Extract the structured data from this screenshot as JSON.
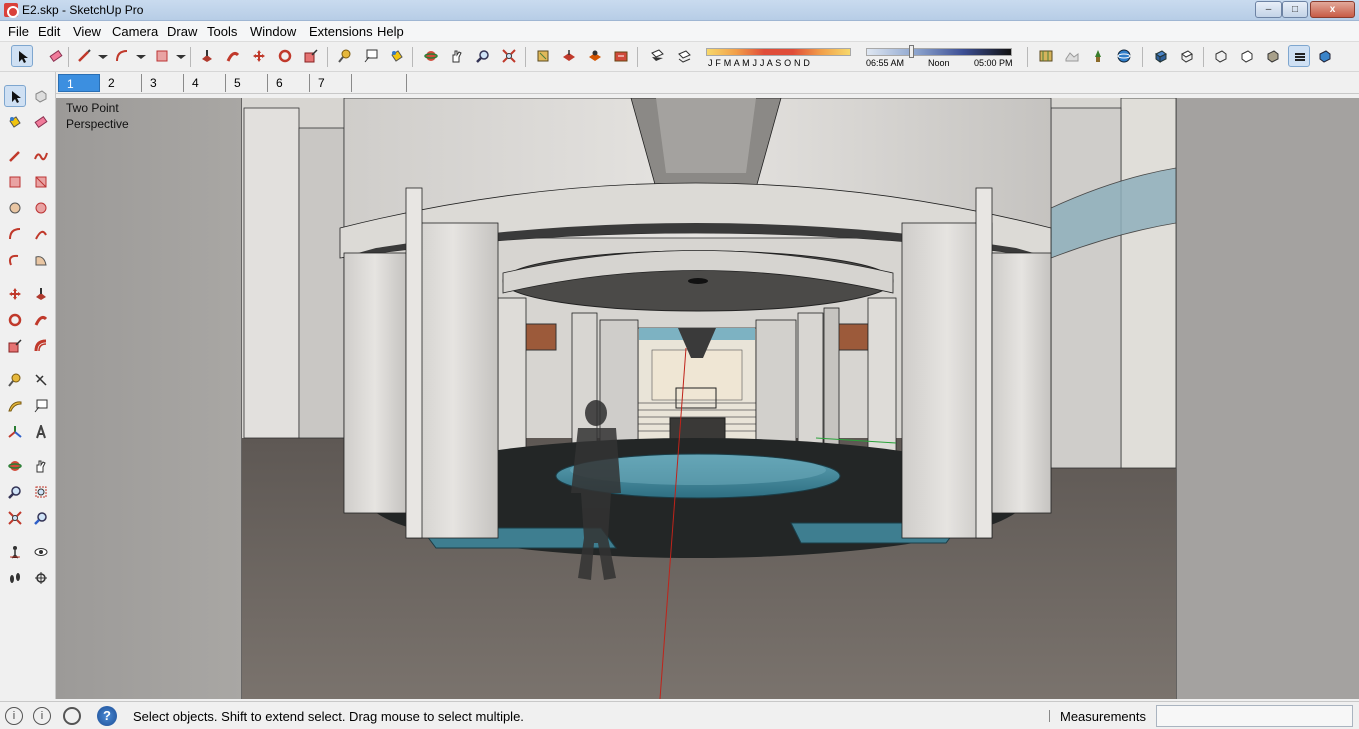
{
  "window": {
    "title": "E2.skp - SketchUp Pro",
    "min_label": "–",
    "max_label": "□",
    "close_label": "x"
  },
  "menu": {
    "items": [
      "File",
      "Edit",
      "View",
      "Camera",
      "Draw",
      "Tools",
      "Window",
      "Extensions",
      "Help"
    ]
  },
  "shadows": {
    "months": "J F M A M J J A S O N D",
    "time_start": "06:55 AM",
    "time_mid": "Noon",
    "time_end": "05:00 PM"
  },
  "scenes": {
    "tabs": [
      "1",
      "2",
      "3",
      "4",
      "5",
      "6",
      "7"
    ],
    "active_index": 0
  },
  "viewport": {
    "camera_label_line1": "Two Point",
    "camera_label_line2": "Perspective"
  },
  "status": {
    "geo_icon": "i",
    "credits_icon": "i",
    "help_icon": "?",
    "message": "Select objects. Shift to extend select. Drag mouse to select multiple.",
    "measurements_label": "Measurements",
    "measurements_value": ""
  },
  "colors": {
    "accent": "#3c8fe0",
    "window_title_gradient_top": "#c9dbef",
    "water": "#3f7f93",
    "floor": "#6b6560"
  }
}
